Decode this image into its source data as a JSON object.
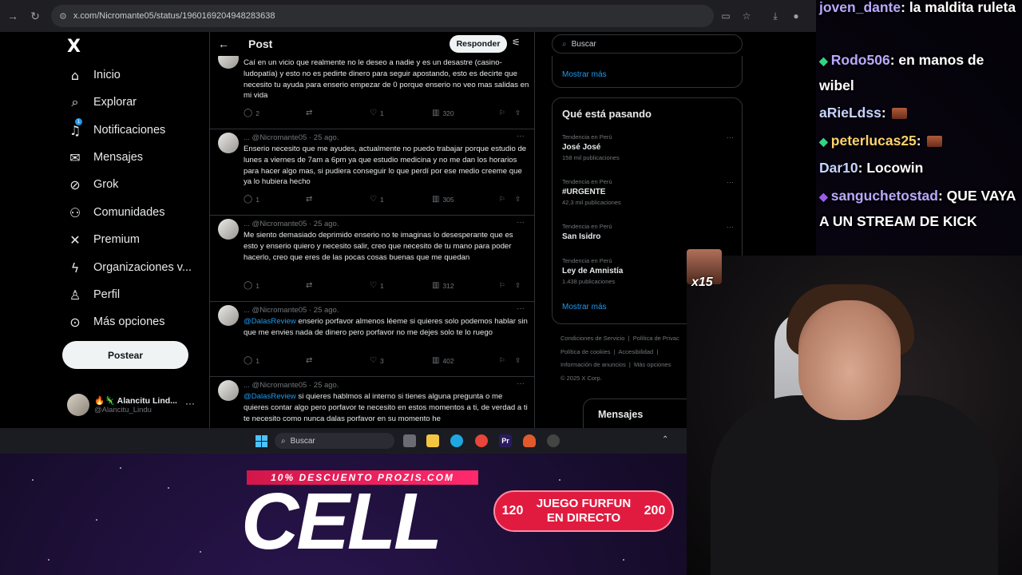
{
  "browser": {
    "url": "x.com/Nicromante05/status/1960169204948283638"
  },
  "sidebar": {
    "logo": "X",
    "items": [
      {
        "label": "Inicio",
        "icon": "home-icon"
      },
      {
        "label": "Explorar",
        "icon": "search-icon"
      },
      {
        "label": "Notificaciones",
        "icon": "bell-icon",
        "badge": "1"
      },
      {
        "label": "Mensajes",
        "icon": "mail-icon"
      },
      {
        "label": "Grok",
        "icon": "grok-icon"
      },
      {
        "label": "Comunidades",
        "icon": "communities-icon"
      },
      {
        "label": "Premium",
        "icon": "x-premium-icon"
      },
      {
        "label": "Organizaciones v...",
        "icon": "lightning-icon"
      },
      {
        "label": "Perfil",
        "icon": "person-icon"
      },
      {
        "label": "Más opciones",
        "icon": "more-circle-icon"
      }
    ],
    "post_button": "Postear",
    "account": {
      "name": "🔥🦎 Alancitu Lind...",
      "handle": "@Alancitu_Lindu"
    }
  },
  "main": {
    "title": "Post",
    "reply_button": "Responder",
    "tweets": [
      {
        "head": "",
        "text": "Caí en un vicio que realmente no le deseo a nadie y es un desastre (casino-ludopatía) y esto no es pedirte dinero para seguir apostando, esto es decirte que necesito tu ayuda para enserio empezar de 0 porque enserio no veo mas salidas en mi vida",
        "replies": "2",
        "likes": "1",
        "views": "320"
      },
      {
        "head": "... @Nicromante05 · 25 ago.",
        "text": "Enserio necesito que me ayudes, actualmente no puedo trabajar porque estudio de lunes a viernes de 7am a 6pm ya que estudio medicina y no me dan los horarios para hacer algo mas, si pudiera conseguir lo que perdí por ese medio creeme que ya lo hubiera hecho",
        "replies": "1",
        "likes": "1",
        "views": "305"
      },
      {
        "head": "... @Nicromante05 · 25 ago.",
        "text": "Me siento demasiado deprimido enserio no te imaginas lo desesperante que es esto y enserio quiero y necesito salir, creo que necesito de tu mano para poder hacerlo, creo que eres de las pocas cosas buenas que me quedan",
        "replies": "1",
        "likes": "1",
        "views": "312"
      },
      {
        "head": "... @Nicromante05 · 25 ago.",
        "mention": "@DalasReview",
        "text": " enserio porfavor almenos léeme si quieres solo podemos hablar sin que me envies nada de dinero pero porfavor no me dejes solo te lo ruego",
        "replies": "1",
        "likes": "3",
        "views": "402"
      },
      {
        "head": "... @Nicromante05 · 25 ago.",
        "mention": "@DalasReview",
        "text": " si quieres hablmos al interno si tienes alguna pregunta o me quieres contar algo pero porfavor te necesito en estos momentos a ti, de verdad a ti te necesito como nunca dalas porfavor en su momento he"
      }
    ]
  },
  "right": {
    "search_placeholder": "Buscar",
    "show_more": "Mostrar más",
    "trending_title": "Qué está pasando",
    "trends": [
      {
        "category": "Tendencia en Perú",
        "name": "José José",
        "count": "158 mil publicaciones"
      },
      {
        "category": "Tendencia en Perú",
        "name": "#URGENTE",
        "count": "42,3 mil publicaciones"
      },
      {
        "category": "Tendencia en Perú",
        "name": "San Isidro",
        "count": ""
      },
      {
        "category": "Tendencia en Perú",
        "name": "Ley de Amnistía",
        "count": "1.438 publicaciones"
      }
    ],
    "show_more_2": "Mostrar más",
    "footer": [
      "Condiciones de Servicio",
      "Política de Privac",
      "Política de cookies",
      "Accesibilidad",
      "Información de anuncios",
      "Más opciones",
      "© 2025 X Corp."
    ],
    "messages": "Mensajes"
  },
  "taskbar": {
    "search": "Buscar"
  },
  "chat": [
    {
      "user": "joven_dante",
      "text": ": la maldita ruleta",
      "user_color": "#b9a9ff",
      "badge": ""
    },
    {
      "user": "Rodo506",
      "text": ": en manos de wibel",
      "user_color": "#b9a9ff",
      "badge": "green"
    },
    {
      "user": "aRieLdss",
      "text": ":",
      "user_color": "#c7d2ff",
      "badge": "",
      "emote": true
    },
    {
      "user": "peterlucas25",
      "text": ":",
      "user_color": "#ffd36b",
      "badge": "green",
      "emote": true
    },
    {
      "user": "Dar10",
      "text": ": Locowin",
      "user_color": "#c7d2ff",
      "badge": ""
    },
    {
      "user": "sanguchetostad",
      "text": ": QUE VAYA A UN STREAM DE KICK",
      "user_color": "#b9a9ff",
      "badge": "purple"
    }
  ],
  "overlay": {
    "emote_multiplier": "x15",
    "promo_banner": "10% DESCUENTO PROZIS.COM",
    "cell_logo": "CELL",
    "furfun_left": "120",
    "furfun_text_1": "JUEGO FURFUN",
    "furfun_text_2": "EN DIRECTO",
    "furfun_right": "200"
  }
}
